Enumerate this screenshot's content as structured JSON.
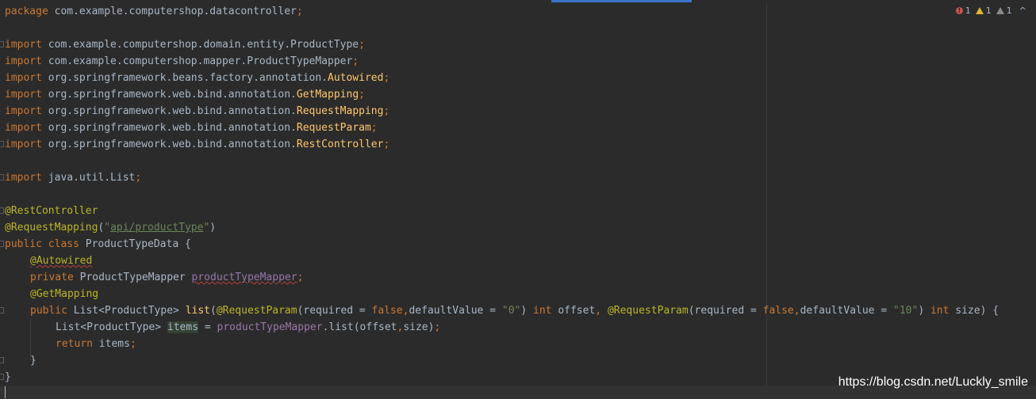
{
  "inspection": {
    "errors": "1",
    "warnings": "1",
    "weak_warnings": "1",
    "collapse": "^"
  },
  "code": {
    "l1": {
      "kw": "package",
      "rest": " com.example.computershop.datacontroller",
      "semi": ";"
    },
    "imports": [
      {
        "kw": "import",
        "pkg": " com.example.computershop.domain.entity.ProductType",
        "cls": "",
        "semi": ";"
      },
      {
        "kw": "import",
        "pkg": " com.example.computershop.mapper.ProductTypeMapper",
        "cls": "",
        "semi": ";"
      },
      {
        "kw": "import",
        "pkg": " org.springframework.beans.factory.annotation.",
        "cls": "Autowired",
        "semi": ";"
      },
      {
        "kw": "import",
        "pkg": " org.springframework.web.bind.annotation.",
        "cls": "GetMapping",
        "semi": ";"
      },
      {
        "kw": "import",
        "pkg": " org.springframework.web.bind.annotation.",
        "cls": "RequestMapping",
        "semi": ";"
      },
      {
        "kw": "import",
        "pkg": " org.springframework.web.bind.annotation.",
        "cls": "RequestParam",
        "semi": ";"
      },
      {
        "kw": "import",
        "pkg": " org.springframework.web.bind.annotation.",
        "cls": "RestController",
        "semi": ";"
      }
    ],
    "import_list": {
      "kw": "import",
      "pkg": " java.util.List",
      "semi": ";"
    },
    "ann_rest": "@RestController",
    "ann_mapping": "@RequestMapping",
    "mapping_open": "(",
    "mapping_q1": "\"",
    "mapping_path": "api/productType",
    "mapping_q2": "\"",
    "mapping_close": ")",
    "class_kw": "public class",
    "class_name": " ProductTypeData {",
    "ann_autowired": "@Autowired",
    "private_kw": "private",
    "field_type": " ProductTypeMapper ",
    "field_name": "productTypeMapper",
    "field_semi": ";",
    "ann_get": "@GetMapping",
    "m_public": "public",
    "m_ret": " List<ProductType> ",
    "m_name": "list",
    "m_open": "(",
    "m_rp1": "@RequestParam",
    "m_args1a": "(required = ",
    "m_false1": "false",
    "m_comma1": ",",
    "m_args1b": "defaultValue = ",
    "m_str1": "\"0\"",
    "m_close1": ") ",
    "m_int1": "int",
    "m_p1": " offset",
    "m_comma2": ", ",
    "m_rp2": "@RequestParam",
    "m_args2a": "(required = ",
    "m_false2": "false",
    "m_comma3": ",",
    "m_args2b": "defaultValue = ",
    "m_str2": "\"10\"",
    "m_close2": ") ",
    "m_int2": "int",
    "m_p2": " size) {",
    "b_type": "List<ProductType> ",
    "b_var": "items",
    "b_eq": " = ",
    "b_field": "productTypeMapper",
    "b_call": ".list(offset",
    "b_comma": ",",
    "b_call2": "size)",
    "b_semi": ";",
    "r_kw": "return",
    "r_rest": " items",
    "r_semi": ";",
    "close_method": "}",
    "close_class": "}"
  },
  "watermark": "https://blog.csdn.net/Luckly_smile"
}
